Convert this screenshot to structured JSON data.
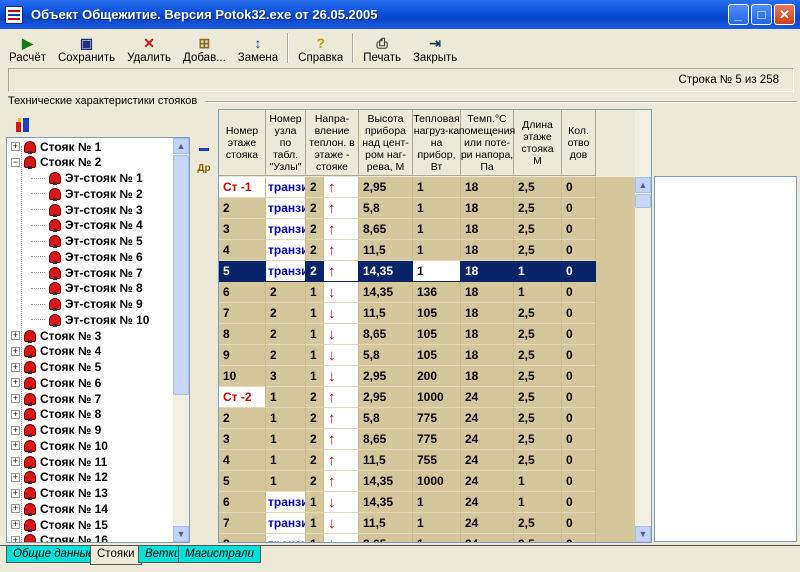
{
  "window": {
    "title": "Объект Общежитие. Версия Potok32.exe от 26.05.2005",
    "min": "_",
    "max": "□",
    "close": "✕"
  },
  "toolbar": [
    {
      "id": "calc",
      "label": "Расчёт",
      "icon": "play-icon",
      "glyph": "▶"
    },
    {
      "id": "save",
      "label": "Сохранить",
      "icon": "floppy-icon",
      "glyph": "▣"
    },
    {
      "id": "delete",
      "label": "Удалить",
      "icon": "delete-x-icon",
      "glyph": "✕"
    },
    {
      "id": "add",
      "label": "Добав...",
      "icon": "add-icon",
      "glyph": "⊞"
    },
    {
      "id": "replace",
      "label": "Замена",
      "icon": "sort-icon",
      "glyph": "↕"
    },
    {
      "id": "help",
      "label": "Справка",
      "icon": "help-icon",
      "glyph": "?"
    },
    {
      "id": "print",
      "label": "Печать",
      "icon": "printer-icon",
      "glyph": "⎙"
    },
    {
      "id": "close",
      "label": "Закрыть",
      "icon": "exit-door-icon",
      "glyph": "⇥"
    }
  ],
  "status": {
    "row_info": "Строка № 5 из 258"
  },
  "section_label": "Технические характеристики стояков",
  "tree": {
    "items": [
      {
        "label": "Стояк № 1",
        "level": 0,
        "expander": "+"
      },
      {
        "label": "Стояк № 2",
        "level": 0,
        "expander": "−"
      },
      {
        "label": "Эт-стояк № 1",
        "level": 1
      },
      {
        "label": "Эт-стояк № 2",
        "level": 1
      },
      {
        "label": "Эт-стояк № 3",
        "level": 1
      },
      {
        "label": "Эт-стояк № 4",
        "level": 1
      },
      {
        "label": "Эт-стояк № 5",
        "level": 1
      },
      {
        "label": "Эт-стояк № 6",
        "level": 1
      },
      {
        "label": "Эт-стояк № 7",
        "level": 1
      },
      {
        "label": "Эт-стояк № 8",
        "level": 1
      },
      {
        "label": "Эт-стояк № 9",
        "level": 1
      },
      {
        "label": "Эт-стояк № 10",
        "level": 1
      },
      {
        "label": "Стояк № 3",
        "level": 0,
        "expander": "+"
      },
      {
        "label": "Стояк № 4",
        "level": 0,
        "expander": "+"
      },
      {
        "label": "Стояк № 5",
        "level": 0,
        "expander": "+"
      },
      {
        "label": "Стояк № 6",
        "level": 0,
        "expander": "+"
      },
      {
        "label": "Стояк № 7",
        "level": 0,
        "expander": "+"
      },
      {
        "label": "Стояк № 8",
        "level": 0,
        "expander": "+"
      },
      {
        "label": "Стояк № 9",
        "level": 0,
        "expander": "+"
      },
      {
        "label": "Стояк № 10",
        "level": 0,
        "expander": "+"
      },
      {
        "label": "Стояк № 11",
        "level": 0,
        "expander": "+"
      },
      {
        "label": "Стояк № 12",
        "level": 0,
        "expander": "+"
      },
      {
        "label": "Стояк № 13",
        "level": 0,
        "expander": "+"
      },
      {
        "label": "Стояк № 14",
        "level": 0,
        "expander": "+"
      },
      {
        "label": "Стояк № 15",
        "level": 0,
        "expander": "+"
      },
      {
        "label": "Стояк № 16",
        "level": 0,
        "expander": "+"
      }
    ]
  },
  "grid": {
    "headers": [
      "Номер этаже стояка",
      "Номер узла по табл. \"Узлы\"",
      "Напра-вление теплон. в этаже - стояке",
      "Высота прибора над цент-ром наг-рева, М",
      "Тепловая нагруз-ка на прибор, Вт",
      "Темп.°С помещения или поте-ри напора, Па",
      "Длина этаже стояка М",
      "Кол. отво дов"
    ],
    "rows": [
      [
        "Ст -1",
        "транзит",
        "2",
        "↑",
        "2,95",
        "1",
        "18",
        "2,5",
        "0"
      ],
      [
        "2",
        "транзит",
        "2",
        "↑",
        "5,8",
        "1",
        "18",
        "2,5",
        "0"
      ],
      [
        "3",
        "транзит",
        "2",
        "↑",
        "8,65",
        "1",
        "18",
        "2,5",
        "0"
      ],
      [
        "4",
        "транзит",
        "2",
        "↑",
        "11,5",
        "1",
        "18",
        "2,5",
        "0"
      ],
      [
        "5",
        "транзит",
        "2",
        "↑",
        "14,35",
        "1",
        "18",
        "1",
        "0"
      ],
      [
        "6",
        "2",
        "1",
        "↓",
        "14,35",
        "136",
        "18",
        "1",
        "0"
      ],
      [
        "7",
        "2",
        "1",
        "↓",
        "11,5",
        "105",
        "18",
        "2,5",
        "0"
      ],
      [
        "8",
        "2",
        "1",
        "↓",
        "8,65",
        "105",
        "18",
        "2,5",
        "0"
      ],
      [
        "9",
        "2",
        "1",
        "↓",
        "5,8",
        "105",
        "18",
        "2,5",
        "0"
      ],
      [
        "10",
        "3",
        "1",
        "↓",
        "2,95",
        "200",
        "18",
        "2,5",
        "0"
      ],
      [
        "Ст -2",
        "1",
        "2",
        "↑",
        "2,95",
        "1000",
        "24",
        "2,5",
        "0"
      ],
      [
        "2",
        "1",
        "2",
        "↑",
        "5,8",
        "775",
        "24",
        "2,5",
        "0"
      ],
      [
        "3",
        "1",
        "2",
        "↑",
        "8,65",
        "775",
        "24",
        "2,5",
        "0"
      ],
      [
        "4",
        "1",
        "2",
        "↑",
        "11,5",
        "755",
        "24",
        "2,5",
        "0"
      ],
      [
        "5",
        "1",
        "2",
        "↑",
        "14,35",
        "1000",
        "24",
        "1",
        "0"
      ],
      [
        "6",
        "транзит",
        "1",
        "↓",
        "14,35",
        "1",
        "24",
        "1",
        "0"
      ],
      [
        "7",
        "транзит",
        "1",
        "↓",
        "11,5",
        "1",
        "24",
        "2,5",
        "0"
      ],
      [
        "8",
        "транзит",
        "1",
        "↓",
        "8,65",
        "1",
        "24",
        "2,5",
        "0"
      ],
      [
        "9",
        "транзит",
        "1",
        "↓",
        "5,8",
        "1",
        "24",
        "2,5",
        "0"
      ]
    ],
    "selected_row": 4,
    "editing_value": "1"
  },
  "tabs": [
    {
      "label": "Общие данные",
      "active": false
    },
    {
      "label": "Стояки",
      "active": true
    },
    {
      "label": "Ветки",
      "active": false
    },
    {
      "label": "Магистрали",
      "active": false
    }
  ],
  "side_icons": [
    {
      "name": "pipe-icon",
      "glyph": "▬"
    },
    {
      "name": "dr-icon",
      "text": "Др"
    }
  ],
  "colors": {
    "titlebar": "#0a4fd8",
    "grid_bg": "#d4c79c",
    "selected": "#0a246a",
    "tab": "#00dfd8",
    "riser_red": "#d00000",
    "transit_blue": "#0000c0"
  }
}
